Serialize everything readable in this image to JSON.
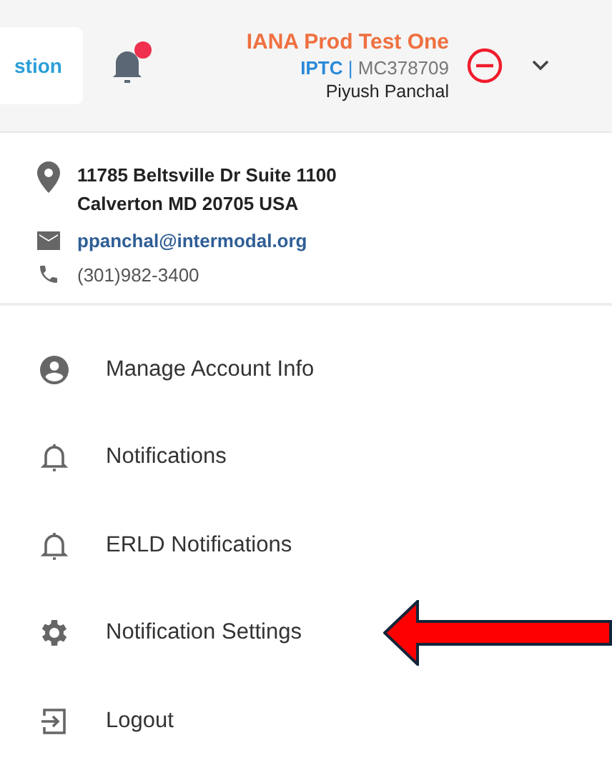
{
  "header": {
    "cut_button": {
      "label": "stion"
    },
    "bell": {
      "has_unread": true
    },
    "account": {
      "org": "IANA Prod Test One",
      "code_prefix": "IPTC",
      "separator": "|",
      "code": "MC378709",
      "user": "Piyush Panchal"
    }
  },
  "contact": {
    "address": [
      "11785 Beltsville Dr Suite 1100",
      "Calverton MD 20705 USA"
    ],
    "email": "ppanchal@intermodal.org",
    "phone": "(301)982-3400"
  },
  "menu": [
    {
      "kind": "account",
      "label": "Manage Account Info",
      "pointed": false
    },
    {
      "kind": "bell",
      "label": "Notifications",
      "pointed": false
    },
    {
      "kind": "bell",
      "label": "ERLD Notifications",
      "pointed": false
    },
    {
      "kind": "gear",
      "label": "Notification Settings",
      "pointed": true
    },
    {
      "kind": "logout",
      "label": "Logout",
      "pointed": false
    }
  ]
}
